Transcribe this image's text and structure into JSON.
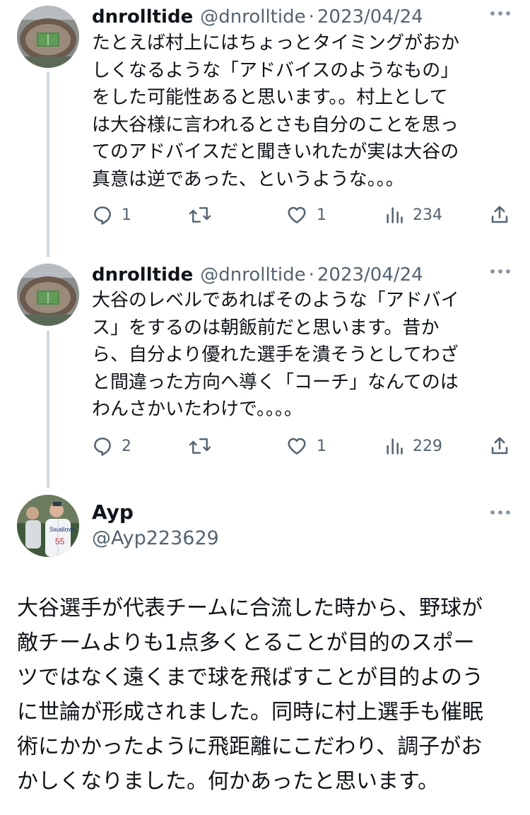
{
  "tweets": [
    {
      "name": "dnrolltide",
      "handle": "@dnrolltide",
      "separator": "·",
      "date": "2023/04/24",
      "lines": [
        "たとえば村上にはちょっとタイミングがおか",
        "しくなるような「アドバイスのようなもの」",
        "をした可能性あると思います。。村上として",
        "は大谷様に言われるとさも自分のことを思っ",
        "てのアドバイスだと聞きいれたが実は大谷の",
        "真意は逆であった、というような。。。"
      ],
      "replies": "1",
      "likes": "1",
      "views": "234"
    },
    {
      "name": "dnrolltide",
      "handle": "@dnrolltide",
      "separator": "·",
      "date": "2023/04/24",
      "lines": [
        "大谷のレベルであればそのような「アドバイ",
        "ス」をするのは朝飯前だと思います。昔か",
        "ら、自分より優れた選手を潰そうとしてわざ",
        "と間違った方向へ導く「コーチ」なんてのは",
        "わんさかいたわけで。。。。"
      ],
      "replies": "2",
      "likes": "1",
      "views": "229"
    }
  ],
  "main": {
    "name": "Ayp",
    "handle": "@Ayp223629",
    "lines": [
      "大谷選手が代表チームに合流した時から、野球が",
      "敵チームよりも1点多くとることが目的のスポー",
      "ツではなく遠くまで球を飛ばすことが目的よのう",
      "に世論が形成されました。同時に村上選手も催眠",
      "術にかかったように飛距離にこだわり、調子がお",
      "かしくなりました。何かあったと思います。"
    ]
  },
  "icons": {
    "reply": "reply-icon",
    "retweet": "retweet-icon",
    "like": "heart-icon",
    "views": "views-icon",
    "share": "share-icon",
    "more": "more-icon"
  },
  "colors": {
    "text": "#0f1419",
    "secondary": "#536471",
    "thread_line": "#cfd9de"
  }
}
